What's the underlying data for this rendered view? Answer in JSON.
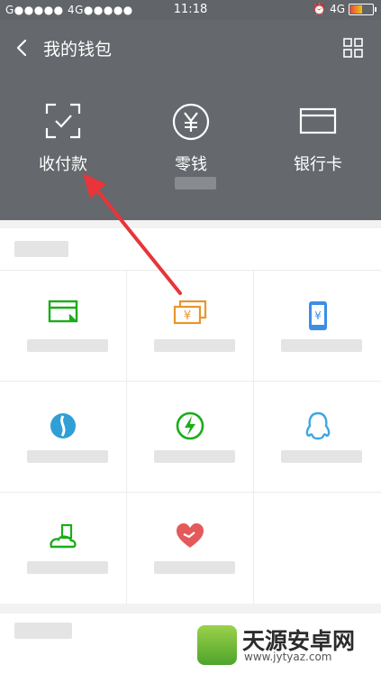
{
  "status": {
    "carrier": "G●●●●● 4G●●●●●",
    "time": "11:18",
    "network": "4G"
  },
  "header": {
    "title": "我的钱包"
  },
  "wallet": [
    {
      "label": "收付款",
      "icon": "scan-check-icon"
    },
    {
      "label": "零钱",
      "icon": "yuan-circle-icon"
    },
    {
      "label": "银行卡",
      "icon": "bank-card-icon"
    }
  ],
  "services": [
    {
      "icon": "credit-card-repay-icon",
      "color": "#1aad19"
    },
    {
      "icon": "cash-transfer-icon",
      "color": "#e8962c"
    },
    {
      "icon": "mobile-topup-icon",
      "color": "#3c8ee6"
    },
    {
      "icon": "wealth-icon",
      "color": "#2f9fd6"
    },
    {
      "icon": "utilities-icon",
      "color": "#1aad19"
    },
    {
      "icon": "qq-coin-icon",
      "color": "#3ca7e0"
    },
    {
      "icon": "city-services-icon",
      "color": "#1aad19"
    },
    {
      "icon": "charity-icon",
      "color": "#e45a5a"
    }
  ],
  "watermark": {
    "text": "天源安卓网",
    "url": "www.jytyaz.com"
  },
  "colors": {
    "header_bg": "#65686d",
    "annotation_arrow": "#e8343a"
  }
}
